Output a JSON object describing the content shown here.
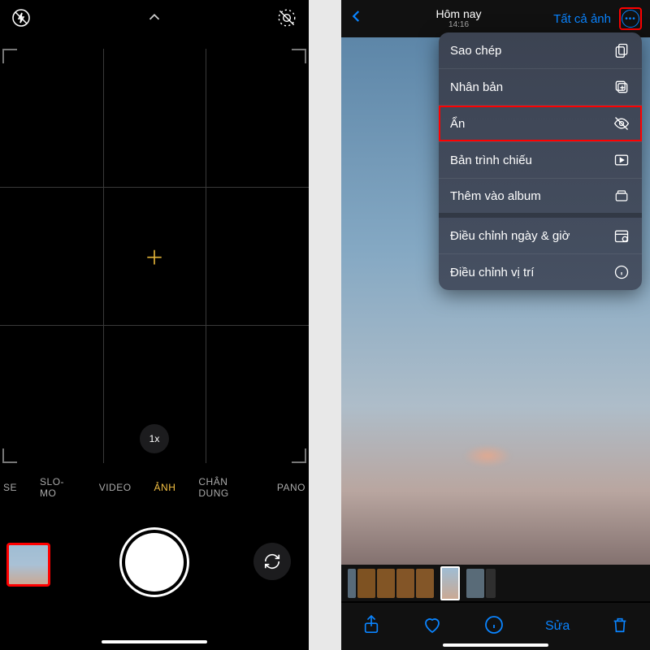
{
  "left": {
    "zoom": "1x",
    "modes": [
      "SE",
      "SLO-MO",
      "VIDEO",
      "ẢNH",
      "CHÂN DUNG",
      "PANO"
    ],
    "active_mode_index": 3
  },
  "right": {
    "header": {
      "title": "Hôm nay",
      "subtitle": "14:16",
      "all_photos": "Tất cả ảnh"
    },
    "menu": [
      {
        "label": "Sao chép",
        "icon": "copy",
        "sep": false,
        "hl": false
      },
      {
        "label": "Nhân bản",
        "icon": "duplicate",
        "sep": false,
        "hl": false
      },
      {
        "label": "Ẩn",
        "icon": "hidden",
        "sep": false,
        "hl": true
      },
      {
        "label": "Bản trình chiếu",
        "icon": "slideshow",
        "sep": false,
        "hl": false
      },
      {
        "label": "Thêm vào album",
        "icon": "album",
        "sep": true,
        "hl": false
      },
      {
        "label": "Điều chỉnh ngày & giờ",
        "icon": "calendar",
        "sep": false,
        "hl": false
      },
      {
        "label": "Điều chỉnh vị trí",
        "icon": "info",
        "sep": false,
        "hl": false
      }
    ],
    "toolbar": {
      "edit": "Sửa"
    }
  }
}
